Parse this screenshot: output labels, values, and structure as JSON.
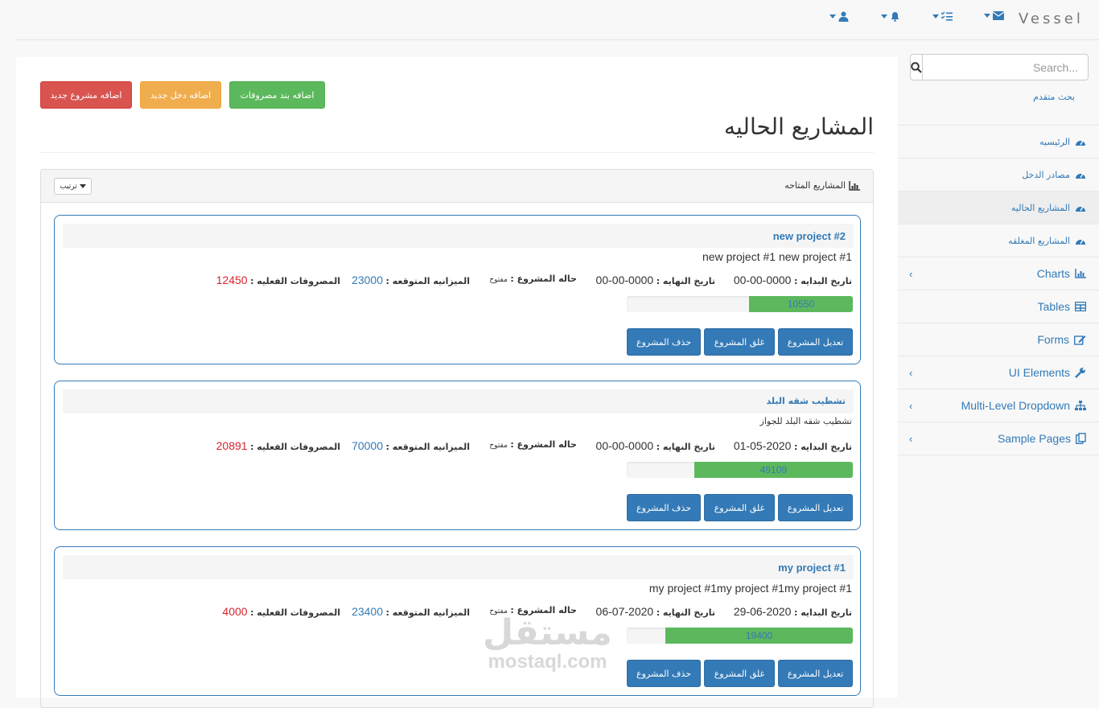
{
  "navbar": {
    "brand": "Vessel",
    "icons": [
      "envelope-icon",
      "tasks-icon",
      "bell-icon",
      "user-icon"
    ]
  },
  "sidebar": {
    "search_placeholder": "Search...",
    "advanced_search": "بحث متقدم",
    "items": [
      {
        "label": "الرئيسيه",
        "icon": "dashboard-icon"
      },
      {
        "label": "مصادر الدخل",
        "icon": "dashboard-icon"
      },
      {
        "label": "المشاريع الحاليه",
        "icon": "dashboard-icon",
        "active": true
      },
      {
        "label": "المشاريع المغلقه",
        "icon": "dashboard-icon"
      },
      {
        "label": "Charts",
        "icon": "bar-chart-icon",
        "has_children": true
      },
      {
        "label": "Tables",
        "icon": "table-icon"
      },
      {
        "label": "Forms",
        "icon": "edit-icon"
      },
      {
        "label": "UI Elements",
        "icon": "wrench-icon",
        "has_children": true
      },
      {
        "label": "Multi-Level Dropdown",
        "icon": "sitemap-icon",
        "has_children": true
      },
      {
        "label": "Sample Pages",
        "icon": "files-icon",
        "has_children": true
      }
    ]
  },
  "actions": {
    "add_expense": "اضافه بند مصروفات",
    "add_income": "اضافه دخل جديد",
    "add_project": "اضافه مشروع جديد"
  },
  "page_title": "المشاريع الحاليه",
  "panel": {
    "title": "المشاريع المتاحه",
    "sort_label": "ترتيب"
  },
  "labels": {
    "start_date": "تاريخ البدايه :",
    "end_date": "تاريخ النهايه :",
    "status": "حاله المشروع :",
    "expected_budget": "الميزانيه المتوقعه :",
    "actual_expenses": "المصروفات الفعليه :",
    "edit": "تعديل المشروع",
    "close": "غلق المشروع",
    "delete": "حذف المشروع"
  },
  "projects": [
    {
      "title": "new project #2",
      "description": "new project #1 new project #1",
      "start_date": "0000-00-00",
      "end_date": "0000-00-00",
      "status": "مفتوح",
      "expected_budget": "23000",
      "actual_expenses": "12450",
      "progress_value": "10550",
      "progress_fraction": 0.459
    },
    {
      "title": "تشطيب شقه البلد",
      "description": "تشطيب شقه البلد للجواز",
      "start_date": "2020-05-01",
      "end_date": "0000-00-00",
      "status": "مفتوح",
      "expected_budget": "70000",
      "actual_expenses": "20891",
      "progress_value": "49109",
      "progress_fraction": 0.702
    },
    {
      "title": "my project #1",
      "description": "my project #1my project #1my project #1",
      "start_date": "2020-06-29",
      "end_date": "2020-07-06",
      "status": "مفتوح",
      "expected_budget": "23400",
      "actual_expenses": "4000",
      "progress_value": "19400",
      "progress_fraction": 0.829
    }
  ],
  "watermark": {
    "arabic": "مستقل",
    "latin": "mostaql.com"
  }
}
